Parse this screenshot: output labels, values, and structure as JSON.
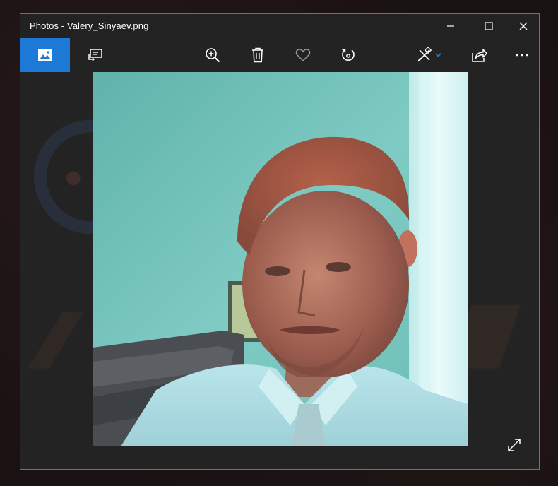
{
  "window": {
    "title": "Photos - Valery_Sinyaev.png"
  },
  "titlebar_controls": {
    "minimize_icon": "minimize-icon",
    "maximize_icon": "maximize-icon",
    "close_icon": "close-icon"
  },
  "toolbar": {
    "items": [
      {
        "name": "view-photo-button",
        "icon": "image-icon",
        "active": true
      },
      {
        "name": "slideshow-button",
        "icon": "slideshow-icon"
      },
      {
        "name": "zoom-button",
        "icon": "zoom-in-icon"
      },
      {
        "name": "delete-button",
        "icon": "trash-icon"
      },
      {
        "name": "favorite-button",
        "icon": "heart-icon"
      },
      {
        "name": "rotate-button",
        "icon": "rotate-icon"
      },
      {
        "name": "edit-create-button",
        "icon": "edit-create-icon"
      },
      {
        "name": "share-button",
        "icon": "share-icon"
      },
      {
        "name": "more-button",
        "icon": "more-icon"
      }
    ]
  },
  "colors": {
    "accent": "#1c7ad6",
    "window_border": "#2f7fd4",
    "window_bg": "#232323",
    "text": "#ffffff",
    "icon": "#ffffff",
    "icon_dim": "#9a9a9a"
  },
  "photo": {
    "description_icon": "portrait-photo",
    "expand_icon": "expand-icon"
  }
}
